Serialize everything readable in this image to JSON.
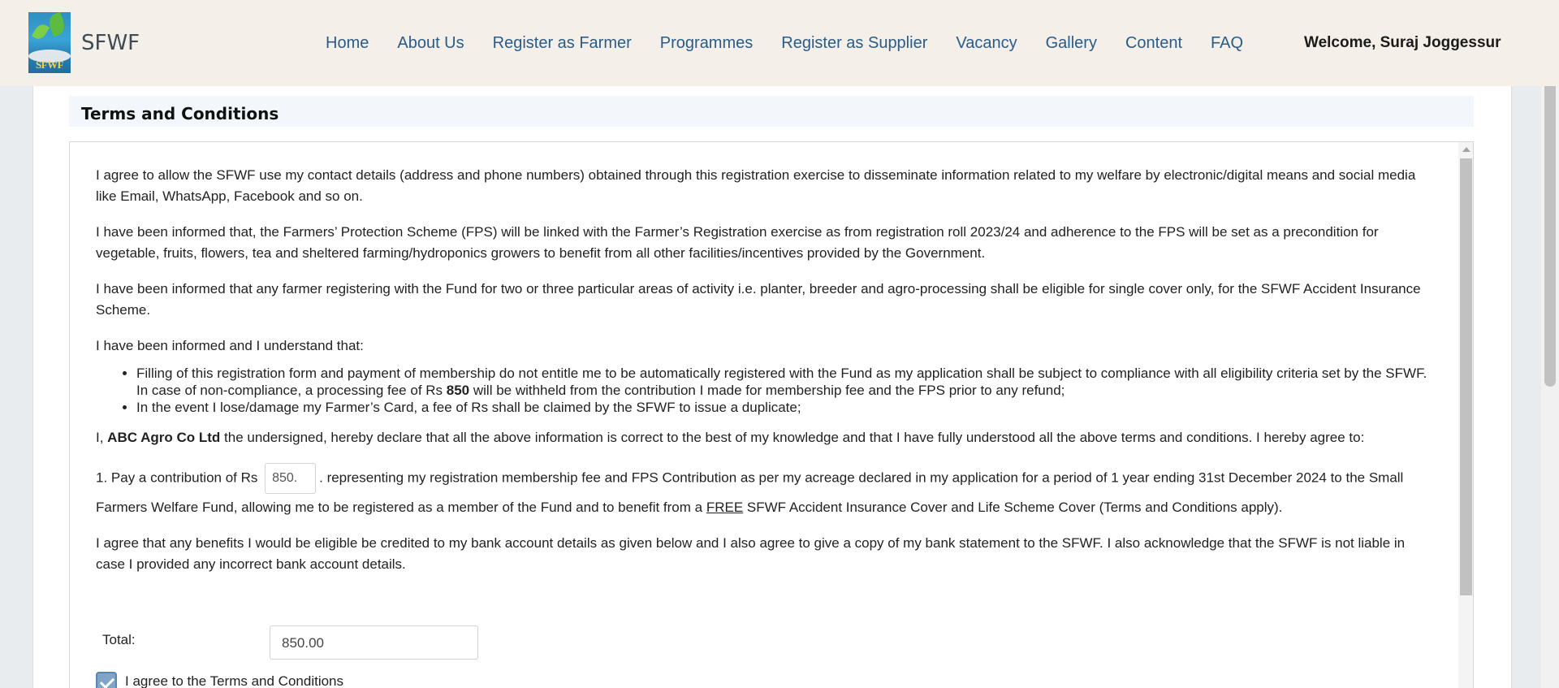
{
  "header": {
    "logo_text": "SFWF",
    "brand": "SFWF",
    "nav": [
      "Home",
      "About Us",
      "Register as Farmer",
      "Programmes",
      "Register as Supplier",
      "Vacancy",
      "Gallery",
      "Content",
      "FAQ"
    ],
    "welcome": "Welcome, Suraj Joggessur"
  },
  "section": {
    "title": "Terms and Conditions"
  },
  "terms": {
    "p1": "I agree to allow the SFWF use my contact details (address and phone numbers) obtained through this registration exercise to disseminate information related to my welfare by electronic/digital means and social media like Email, WhatsApp, Facebook and so on.",
    "p2": "I have been informed that, the Farmers’ Protection Scheme (FPS) will be linked with the Farmer’s Registration exercise as from registration roll 2023/24 and adherence to the FPS will be set as a precondition for vegetable, fruits, flowers, tea and sheltered farming/hydroponics growers to benefit from all other facilities/incentives provided by the Government.",
    "p3": "I have been informed that any farmer registering with the Fund for two or three particular areas of activity i.e. planter, breeder and agro-processing shall be eligible for single cover only, for the SFWF Accident Insurance Scheme.",
    "p4": "I have been informed and I understand that:",
    "bullet1_a": "Filling of this registration form and payment of membership do not entitle me to be automatically registered with the Fund as my application shall be subject to compliance with all eligibility criteria set by the SFWF. In case of non-compliance, a processing fee of Rs ",
    "bullet1_fee": "850",
    "bullet1_b": " will be withheld from the contribution I made for membership fee and the FPS prior to any refund;",
    "bullet2": "In the event I lose/damage my Farmer’s Card, a fee of Rs shall be claimed by the SFWF to issue a duplicate;",
    "declare_a": "I, ",
    "declare_name": "ABC Agro Co Ltd",
    "declare_b": " the undersigned, hereby declare that all the above information is correct to the best of my knowledge and that I have fully understood all the above terms and conditions. I hereby agree to:",
    "contrib_a": "1. Pay a contribution of Rs",
    "contrib_value": "850.",
    "contrib_b": ". representing my registration membership fee and FPS Contribution as per my acreage declared in my application for a period of 1 year ending 31st December 2024 to the Small Farmers Welfare Fund, allowing me to be registered as a member of the Fund and to benefit from a ",
    "contrib_free": "FREE",
    "contrib_c": " SFWF Accident Insurance Cover and Life Scheme Cover (Terms and Conditions apply).",
    "p_bank": "I agree that any benefits I would be eligible be credited to my bank account details as given below and I also agree to give a copy of my bank statement to the SFWF. I also acknowledge that the SFWF is not liable in case I provided any incorrect bank account details."
  },
  "total": {
    "label": "Total:",
    "value": "850.00"
  },
  "agree": {
    "label": "I agree to the Terms and Conditions",
    "checked": true
  },
  "colors": {
    "header_bg": "#f4efe9",
    "nav_link": "#2a5c8a",
    "checkbox": "#7ea4c8"
  }
}
